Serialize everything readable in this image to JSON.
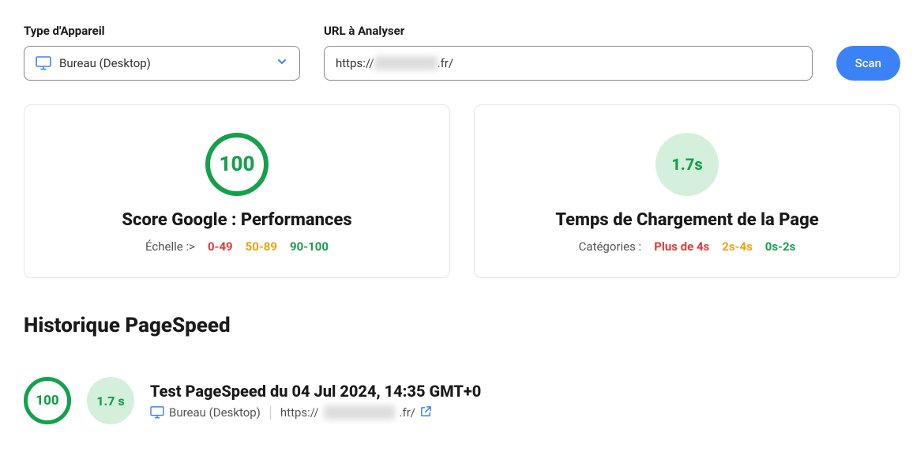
{
  "form": {
    "device_label": "Type d'Appareil",
    "device_value": "Bureau (Desktop)",
    "url_label": "URL à Analyser",
    "url_prefix": "https://",
    "url_blurred": "xxxxxxxx",
    "url_suffix": ".fr/",
    "scan_button": "Scan"
  },
  "cards": {
    "score": {
      "value": "100",
      "title": "Score Google : Performances",
      "scale_label": "Échelle :>",
      "range_red": "0-49",
      "range_orange": "50-89",
      "range_green": "90-100"
    },
    "loadtime": {
      "value": "1.7s",
      "title": "Temps de Chargement de la Page",
      "scale_label": "Catégories :",
      "range_red": "Plus de 4s",
      "range_orange": "2s-4s",
      "range_green": "0s-2s"
    }
  },
  "history": {
    "title": "Historique PageSpeed",
    "entry": {
      "score": "100",
      "time": "1.7 s",
      "title": "Test PageSpeed du 04 Jul 2024, 14:35 GMT+0",
      "device": "Bureau (Desktop)",
      "url_prefix": "https://",
      "url_blurred": "xxxxxxxx",
      "url_suffix": ".fr/"
    }
  }
}
